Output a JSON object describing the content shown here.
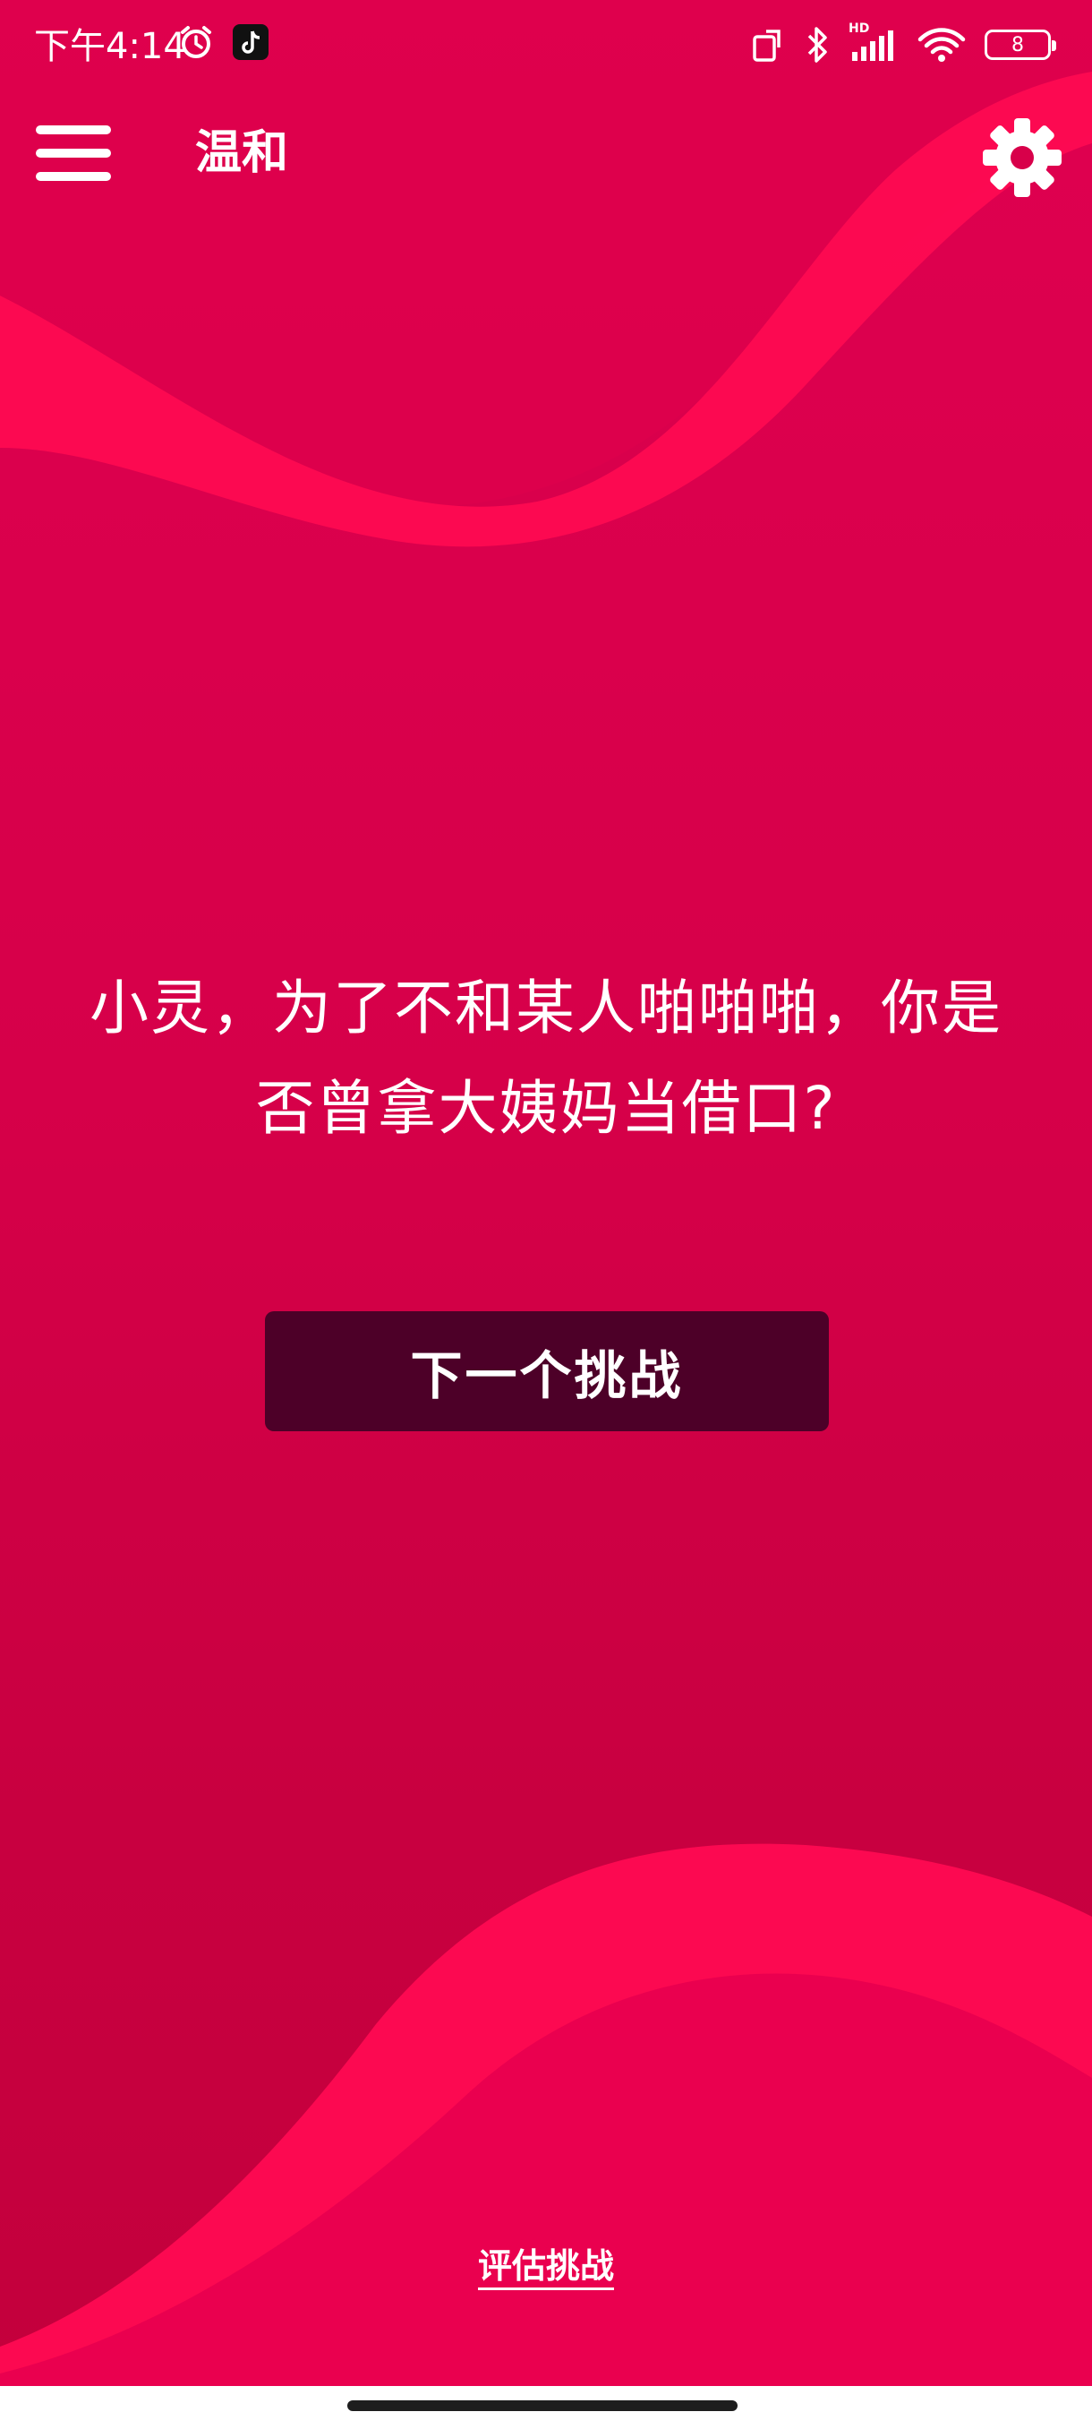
{
  "status_bar": {
    "time": "下午4:14",
    "battery_level": "8",
    "network_badge": "HD",
    "icons": [
      "alarm-icon",
      "tiktok-icon",
      "screen-rotate-icon",
      "bluetooth-icon",
      "cellular-signal-icon",
      "wifi-icon",
      "battery-icon"
    ]
  },
  "app_bar": {
    "menu_icon": "hamburger-menu-icon",
    "mode_title": "温和",
    "settings_icon": "gear-icon"
  },
  "challenge": {
    "question": "小灵，为了不和某人啪啪啪，你是否曾拿大姨妈当借口?"
  },
  "actions": {
    "next_label": "下一个挑战",
    "rate_label": "评估挑战"
  },
  "colors": {
    "background": "#d60049",
    "wave_accent": "#ff0a52",
    "button": "#4d0028",
    "text": "#ffffff"
  }
}
